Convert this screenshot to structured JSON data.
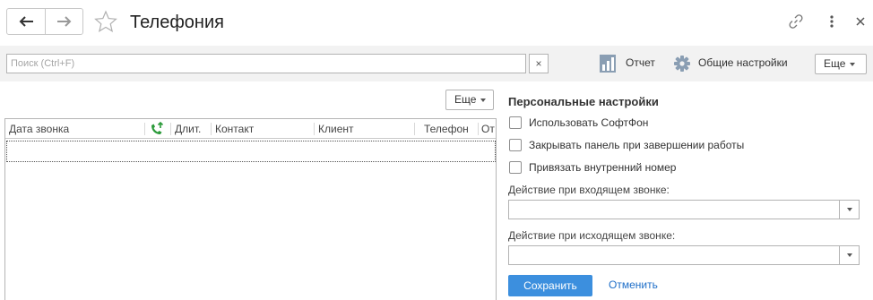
{
  "header": {
    "title": "Телефония",
    "back_icon": "arrow-left-icon",
    "forward_icon": "arrow-right-icon",
    "favorite_icon": "star-icon",
    "link_icon": "link-icon",
    "more_icon": "more-vertical-icon",
    "close_icon": "close-icon"
  },
  "toolbar": {
    "search_placeholder": "Поиск (Ctrl+F)",
    "clear_label": "×",
    "report_label": "Отчет",
    "settings_label": "Общие настройки",
    "more_label": "Еще"
  },
  "list": {
    "more_label": "Еще",
    "columns": [
      "Дата звонка",
      "",
      "Длит.",
      "Контакт",
      "Клиент",
      "Телефон",
      "От"
    ],
    "rows": []
  },
  "panel": {
    "title": "Персональные настройки",
    "checkboxes": [
      {
        "label": "Использовать СофтФон",
        "checked": false
      },
      {
        "label": "Закрывать панель при завершении работы",
        "checked": false
      },
      {
        "label": "Привязать внутренний номер",
        "checked": false
      }
    ],
    "incoming_label": "Действие при входящем звонке:",
    "incoming_value": "",
    "outgoing_label": "Действие при исходящем звонке:",
    "outgoing_value": "",
    "save_label": "Сохранить",
    "cancel_label": "Отменить"
  },
  "colors": {
    "accent": "#3c8fde",
    "link": "#1e6ec8",
    "call_icon": "#2b9a3a"
  }
}
